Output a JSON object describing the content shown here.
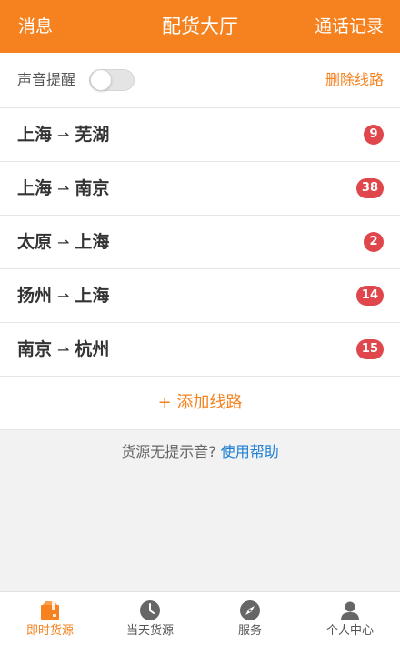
{
  "header": {
    "left": "消息",
    "title": "配货大厅",
    "right": "通话记录"
  },
  "sound": {
    "label": "声音提醒",
    "enabled": false,
    "delete_label": "删除线路"
  },
  "routes": [
    {
      "from": "上海",
      "arrow": "⇀",
      "to": "芜湖",
      "count": "9"
    },
    {
      "from": "上海",
      "arrow": "⇀",
      "to": "南京",
      "count": "38"
    },
    {
      "from": "太原",
      "arrow": "⇀",
      "to": "上海",
      "count": "2"
    },
    {
      "from": "扬州",
      "arrow": "⇀",
      "to": "上海",
      "count": "14"
    },
    {
      "from": "南京",
      "arrow": "⇀",
      "to": "杭州",
      "count": "15"
    }
  ],
  "add_route": "+ 添加线路",
  "hint": {
    "text": "货源无提示音?",
    "link": "使用帮助"
  },
  "tabs": [
    {
      "label": "即时货源",
      "icon": "package-icon",
      "active": true
    },
    {
      "label": "当天货源",
      "icon": "clock-icon",
      "active": false
    },
    {
      "label": "服务",
      "icon": "compass-icon",
      "active": false
    },
    {
      "label": "个人中心",
      "icon": "person-icon",
      "active": false
    }
  ],
  "colors": {
    "accent": "#f5821f",
    "badge": "#e0474c",
    "link": "#1f7fd4"
  }
}
